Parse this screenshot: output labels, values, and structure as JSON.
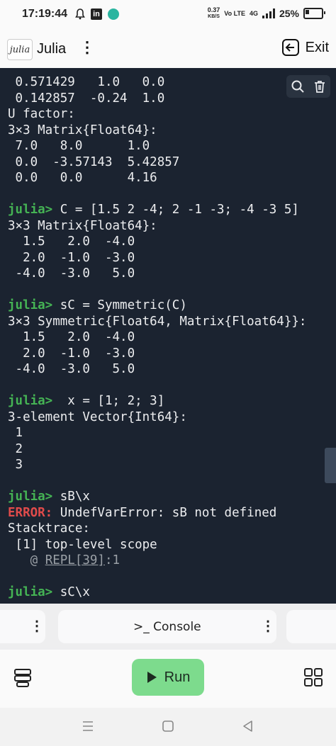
{
  "status_bar": {
    "time": "17:19:44",
    "speed_value": "0.37",
    "speed_unit": "KB/S",
    "volte": "Vo LTE",
    "network": "4G",
    "battery": "25%"
  },
  "app_bar": {
    "logo_text": "julia",
    "title": "Julia",
    "menu_glyph": "⋮",
    "exit_label": "Exit"
  },
  "terminal": {
    "lines": [
      {
        "parts": [
          {
            "t": " 0.571429   1.0   0.0"
          }
        ]
      },
      {
        "parts": [
          {
            "t": " 0.142857  -0.24  1.0"
          }
        ]
      },
      {
        "parts": [
          {
            "t": "U factor:"
          }
        ]
      },
      {
        "parts": [
          {
            "t": "3×3 Matrix{Float64}:"
          }
        ]
      },
      {
        "parts": [
          {
            "t": " 7.0   8.0      1.0"
          }
        ]
      },
      {
        "parts": [
          {
            "t": " 0.0  -3.57143  5.42857"
          }
        ]
      },
      {
        "parts": [
          {
            "t": " 0.0   0.0      4.16"
          }
        ]
      },
      {
        "parts": [
          {
            "t": ""
          }
        ]
      },
      {
        "parts": [
          {
            "t": "julia>",
            "c": "prompt"
          },
          {
            "t": " C = [1.5 2 -4; 2 -1 -3; -4 -3 5]"
          }
        ]
      },
      {
        "parts": [
          {
            "t": "3×3 Matrix{Float64}:"
          }
        ]
      },
      {
        "parts": [
          {
            "t": "  1.5   2.0  -4.0"
          }
        ]
      },
      {
        "parts": [
          {
            "t": "  2.0  -1.0  -3.0"
          }
        ]
      },
      {
        "parts": [
          {
            "t": " -4.0  -3.0   5.0"
          }
        ]
      },
      {
        "parts": [
          {
            "t": ""
          }
        ]
      },
      {
        "parts": [
          {
            "t": "julia>",
            "c": "prompt"
          },
          {
            "t": " sC = Symmetric(C)"
          }
        ]
      },
      {
        "parts": [
          {
            "t": "3×3 Symmetric{Float64, Matrix{Float64}}:"
          }
        ]
      },
      {
        "parts": [
          {
            "t": "  1.5   2.0  -4.0"
          }
        ]
      },
      {
        "parts": [
          {
            "t": "  2.0  -1.0  -3.0"
          }
        ]
      },
      {
        "parts": [
          {
            "t": " -4.0  -3.0   5.0"
          }
        ]
      },
      {
        "parts": [
          {
            "t": ""
          }
        ]
      },
      {
        "parts": [
          {
            "t": "julia>",
            "c": "prompt"
          },
          {
            "t": "  x = [1; 2; 3]"
          }
        ]
      },
      {
        "parts": [
          {
            "t": "3-element Vector{Int64}:"
          }
        ]
      },
      {
        "parts": [
          {
            "t": " 1"
          }
        ]
      },
      {
        "parts": [
          {
            "t": " 2"
          }
        ]
      },
      {
        "parts": [
          {
            "t": " 3"
          }
        ]
      },
      {
        "parts": [
          {
            "t": ""
          }
        ]
      },
      {
        "parts": [
          {
            "t": "julia>",
            "c": "prompt"
          },
          {
            "t": " sB\\x"
          }
        ]
      },
      {
        "parts": [
          {
            "t": "ERROR:",
            "c": "err"
          },
          {
            "t": " UndefVarError: sB not defined"
          }
        ]
      },
      {
        "parts": [
          {
            "t": "Stacktrace:"
          }
        ]
      },
      {
        "parts": [
          {
            "t": " [1] top-level scope"
          }
        ]
      },
      {
        "parts": [
          {
            "t": "   @ ",
            "c": "dim"
          },
          {
            "t": "REPL[39]",
            "c": "link"
          },
          {
            "t": ":1",
            "c": "dim"
          }
        ]
      },
      {
        "parts": [
          {
            "t": ""
          }
        ]
      },
      {
        "parts": [
          {
            "t": "julia>",
            "c": "prompt"
          },
          {
            "t": " sC\\x"
          }
        ]
      }
    ]
  },
  "tabs": {
    "left_dots": "⋮",
    "console_label": ">_  Console",
    "console_dots": "⋮"
  },
  "toolbar": {
    "run_label": "Run"
  },
  "colors": {
    "terminal_bg": "#1b2330",
    "prompt_green": "#45b354",
    "error_red": "#e04b4b",
    "run_green": "#7ddb8d"
  },
  "icons": [
    "bell-icon",
    "linkedin-icon",
    "chat-icon",
    "signal-icon",
    "battery-icon",
    "exit-icon",
    "search-icon",
    "trash-icon",
    "stack-icon",
    "play-icon",
    "grid-icon",
    "nav-menu-icon",
    "nav-home-icon",
    "nav-back-icon"
  ]
}
